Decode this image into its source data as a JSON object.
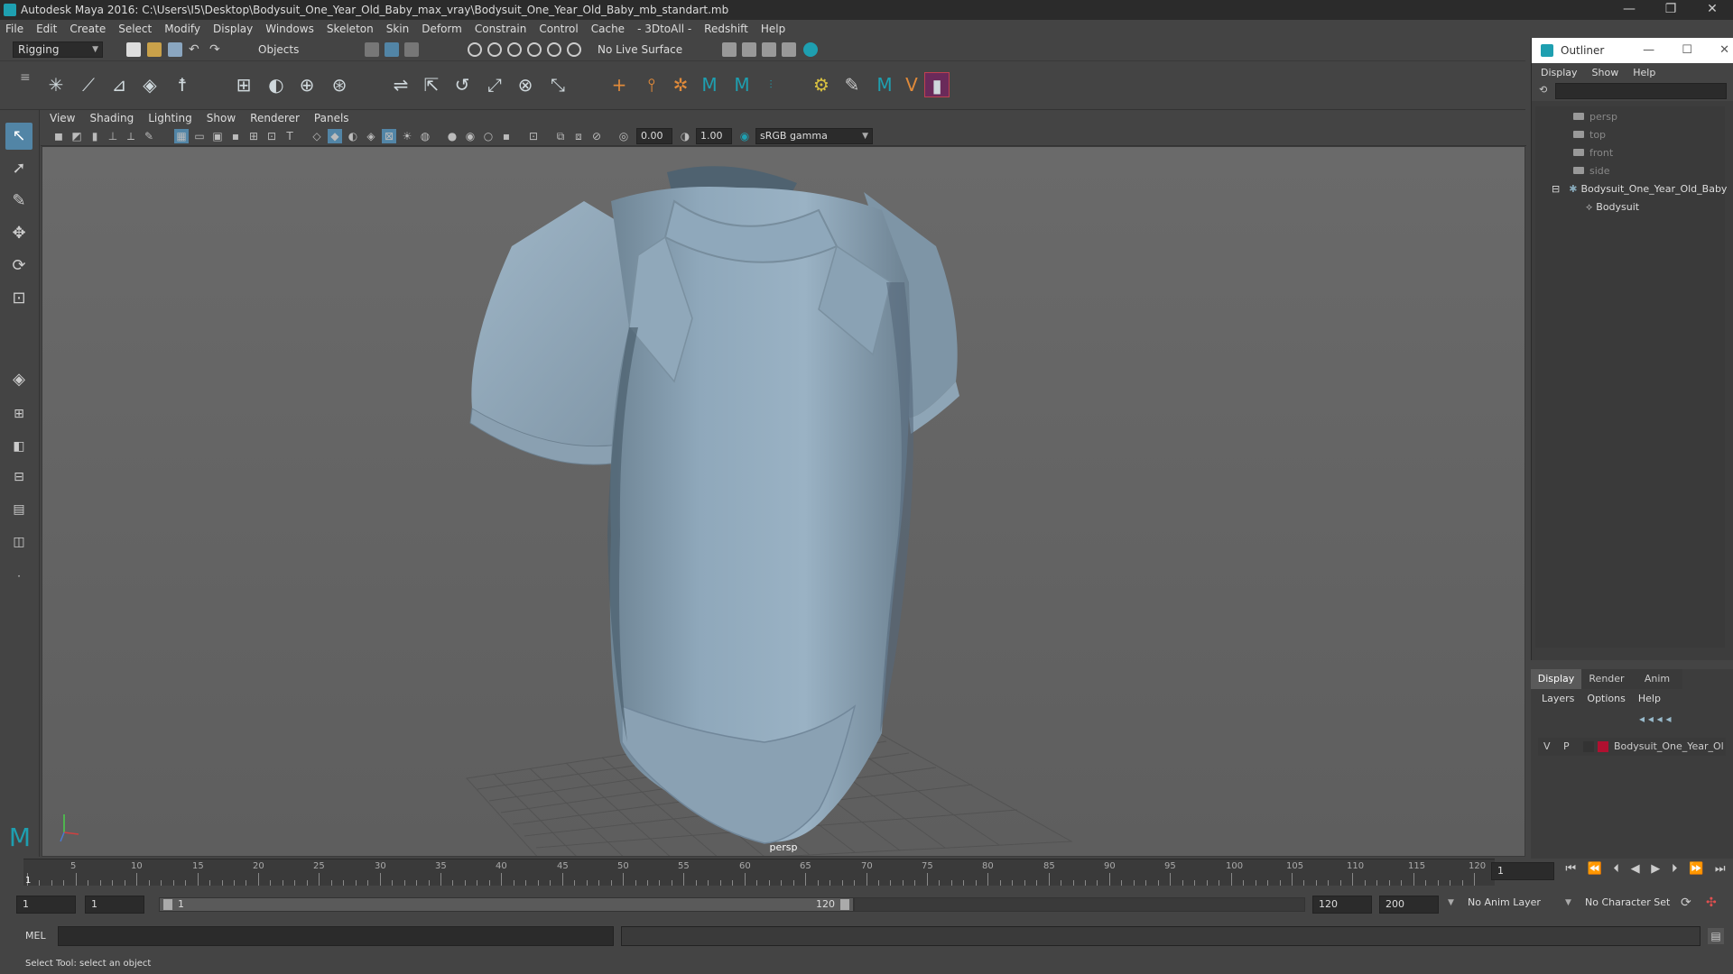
{
  "window": {
    "title": "Autodesk Maya 2016: C:\\Users\\I5\\Desktop\\Bodysuit_One_Year_Old_Baby_max_vray\\Bodysuit_One_Year_Old_Baby_mb_standart.mb",
    "minimize": "—",
    "restore": "❐",
    "close": "✕"
  },
  "menubar": [
    "File",
    "Edit",
    "Create",
    "Select",
    "Modify",
    "Display",
    "Windows",
    "Skeleton",
    "Skin",
    "Deform",
    "Constrain",
    "Control",
    "Cache",
    "- 3DtoAll -",
    "Redshift",
    "Help"
  ],
  "statusline": {
    "menuset": "Rigging",
    "selection_mode": "Objects",
    "live_surface": "No Live Surface"
  },
  "panel": {
    "menus": [
      "View",
      "Shading",
      "Lighting",
      "Show",
      "Renderer",
      "Panels"
    ],
    "exposure": "0.00",
    "gamma": "1.00",
    "color_space": "sRGB gamma",
    "camera_label": "persp"
  },
  "outliner": {
    "title": "Outliner",
    "menus": [
      "Display",
      "Show",
      "Help"
    ],
    "items": [
      "persp",
      "top",
      "front",
      "side",
      "Bodysuit_One_Year_Old_Baby",
      "Bodysuit"
    ]
  },
  "layer_editor": {
    "tabs": [
      "Display",
      "Render",
      "Anim"
    ],
    "menus": [
      "Layers",
      "Options",
      "Help"
    ],
    "layer": {
      "v": "V",
      "p": "P",
      "name": "Bodysuit_One_Year_Ol",
      "color": "#b01030"
    }
  },
  "timeline": {
    "ticks": [
      "5",
      "10",
      "15",
      "20",
      "25",
      "30",
      "35",
      "40",
      "45",
      "50",
      "55",
      "60",
      "65",
      "70",
      "75",
      "80",
      "85",
      "90",
      "95",
      "100",
      "105",
      "110",
      "115",
      "120"
    ],
    "first_tick": "1",
    "current_frame": "1"
  },
  "range": {
    "start": "1",
    "playback_start": "1",
    "slider_start": "1",
    "slider_end": "120",
    "playback_end": "120",
    "end": "200",
    "anim_layer": "No Anim Layer",
    "character_set": "No Character Set"
  },
  "command": {
    "lang": "MEL"
  },
  "help": {
    "text": "Select Tool: select an object"
  },
  "colors": {
    "accent": "#5285a6",
    "maya_teal": "#1e9fb0",
    "bodysuit": "#8fa8bb"
  }
}
